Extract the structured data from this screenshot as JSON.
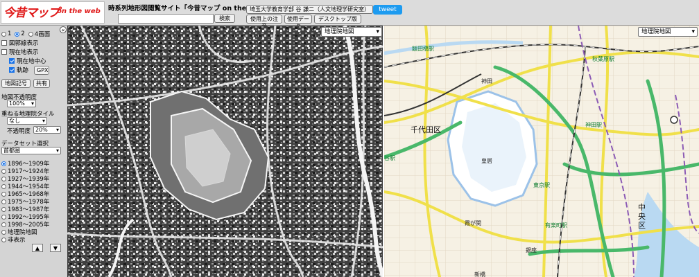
{
  "header": {
    "logo_main": "今昔マップ",
    "logo_sub": "on the web",
    "site_title": "時系列地形図閲覧サイト「今昔マップ on the web」",
    "search_placeholder": "",
    "search_button": "検索",
    "author": "埼玉大学教育学部 谷 謙二（人文地理学研究室）",
    "notice_button": "使用上の注意",
    "data_button": "使用データ",
    "desktop_button": "デスクトップ版",
    "tweet": "tweet"
  },
  "sidebar": {
    "collapse_icon": "«",
    "screens": [
      {
        "label": "1",
        "selected": false
      },
      {
        "label": "2",
        "selected": true
      },
      {
        "label": "4画面",
        "selected": false
      }
    ],
    "options": [
      {
        "label": "図郭線表示",
        "checked": false
      },
      {
        "label": "現在地表示",
        "checked": false
      },
      {
        "label": "現在地中心",
        "checked": true
      },
      {
        "label": "軌跡",
        "checked": true
      }
    ],
    "gpx_button": "GPX",
    "symbols_button": "地図記号",
    "share_button": "共有",
    "opacity_label": "地図不透明度",
    "opacity_value": "100%",
    "overlay_label": "重ねる地理院タイル",
    "overlay_value": "なし",
    "overlay_opacity_label": "不透明度",
    "overlay_opacity_value": "20%",
    "dataset_label": "データセット選択",
    "dataset_value": "首都圏",
    "periods": [
      {
        "label": "1896～1909年",
        "selected": true
      },
      {
        "label": "1917～1924年",
        "selected": false
      },
      {
        "label": "1927～1939年",
        "selected": false
      },
      {
        "label": "1944～1954年",
        "selected": false
      },
      {
        "label": "1965～1968年",
        "selected": false
      },
      {
        "label": "1975～1978年",
        "selected": false
      },
      {
        "label": "1983～1987年",
        "selected": false
      },
      {
        "label": "1992～1995年",
        "selected": false
      },
      {
        "label": "1998～2005年",
        "selected": false
      },
      {
        "label": "地理院地図",
        "selected": false
      },
      {
        "label": "非表示",
        "selected": false
      }
    ],
    "up_icon": "▲",
    "down_icon": "▼"
  },
  "map_left": {
    "layer_select": "地理院地図"
  },
  "map_right": {
    "layer_select": "地理院地図",
    "labels": {
      "iidabashi": "飯田橋駅",
      "akihabara": "秋葉原駅",
      "kanda": "神田",
      "kanda_st": "神田駅",
      "chiyoda": "千代田区",
      "kokyo": "皇居",
      "tokyo_st": "東京駅",
      "kasumigaseki": "霞が関",
      "ginza": "銀座",
      "yurakucho": "有楽町駅",
      "chuo": "中央\n区",
      "yotsuya": "谷駅",
      "shinbashi": "新橋"
    }
  },
  "colors": {
    "tweet_bg": "#1d9bf0",
    "check_blue": "#1a73e8",
    "logo_red": "#e01818",
    "road_yellow": "#f0e04a",
    "road_green": "#49b86a",
    "water_blue": "#b9d9f2"
  }
}
